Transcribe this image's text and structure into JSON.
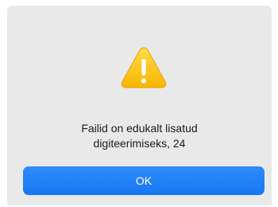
{
  "dialog": {
    "icon": "warning-icon",
    "message": "Failid on edukalt lisatud\ndigiteerimiseks, 24",
    "ok_label": "OK",
    "accent_color": "#1677f2",
    "icon_color": "#ffcd2a"
  }
}
